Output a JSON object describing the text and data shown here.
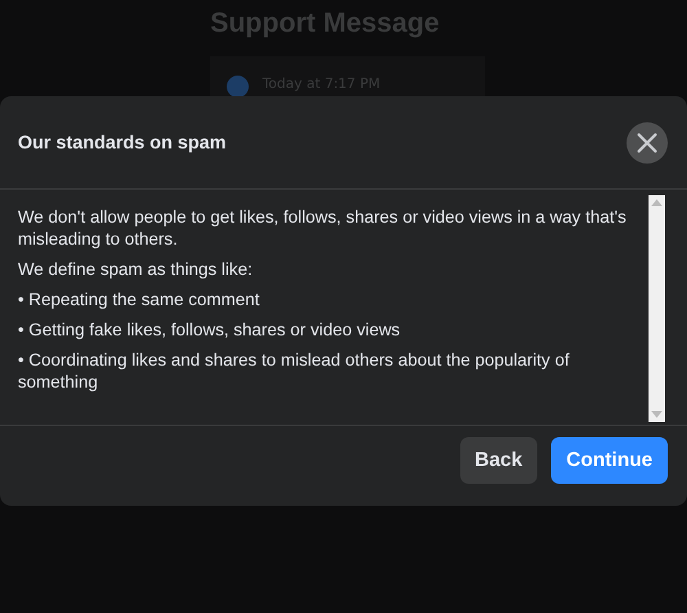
{
  "background": {
    "title": "Support Message",
    "message_time": "Today at 7:17 PM"
  },
  "dialog": {
    "title": "Our standards on spam",
    "paragraphs": [
      "We don't allow people to get likes, follows, shares or video views in a way that's misleading to others.",
      "We define spam as things like:"
    ],
    "bullets": [
      "• Repeating the same comment",
      "• Getting fake likes, follows, shares or video views",
      "• Coordinating likes and shares to mislead others about the popularity of something"
    ],
    "buttons": [
      {
        "label": "Back",
        "kind": "secondary"
      },
      {
        "label": "Continue",
        "kind": "primary"
      }
    ]
  }
}
